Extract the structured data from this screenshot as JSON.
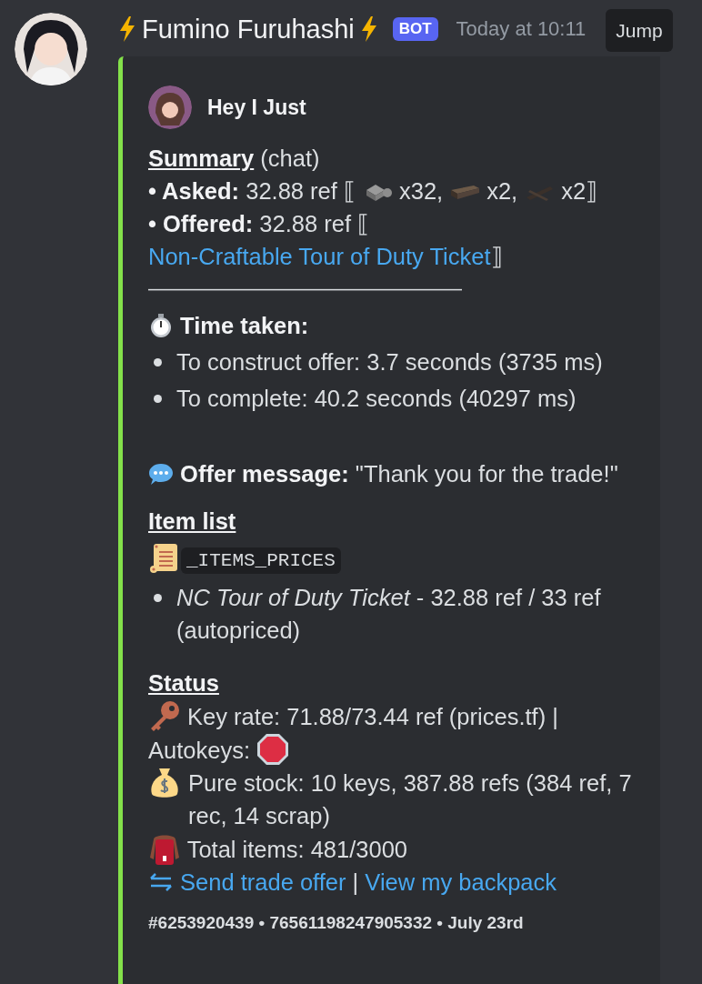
{
  "message": {
    "author": "Fumino Furuhashi",
    "badge": "BOT",
    "timestamp": "Today at 10:11",
    "jump_button": "Jump"
  },
  "embed": {
    "author": "Hey I Just",
    "summary": {
      "heading": "Summary",
      "note": "(chat)"
    },
    "asked": {
      "bullet": "•",
      "label": "Asked:",
      "value": "32.88 ref",
      "open": "⟦",
      "items": [
        {
          "count": "x32,"
        },
        {
          "count": "x2,"
        },
        {
          "count": "x2"
        }
      ],
      "close": "⟧"
    },
    "offered": {
      "bullet": "•",
      "label": "Offered:",
      "value": "32.88 ref",
      "open": "⟦",
      "link": "Non-Craftable Tour of Duty Ticket",
      "close": "⟧"
    },
    "divider": "———————————————————————",
    "time_taken": {
      "heading": "Time taken:",
      "items": [
        "To construct offer: 3.7 seconds (3735 ms)",
        "To complete: 40.2 seconds (40297 ms)"
      ]
    },
    "offer_message": "**Offer message:** \"Thank you for the trade!\"",
    "item_list": {
      "heading": "Item list",
      "code": "_ITEMS_PRICES",
      "items": [
        "*NC Tour of Duty Ticket* - 32.88 ref / 33 ref (autopriced)"
      ]
    },
    "status": {
      "heading": "Status",
      "key_rate": "Key rate: 71.88/73.44 ref (prices.tf) |",
      "autokeys": "Autokeys:",
      "pure_stock": "Pure stock: 10 keys, 387.88 refs (384 ref, 7 rec, 14 scrap)",
      "total_items": "Total items: 481/3000",
      "links": [
        "Send trade offer",
        "View my backpack"
      ],
      "separator": "|"
    },
    "footer": "#6253920439 • 76561198247905332 • July 23rd"
  }
}
